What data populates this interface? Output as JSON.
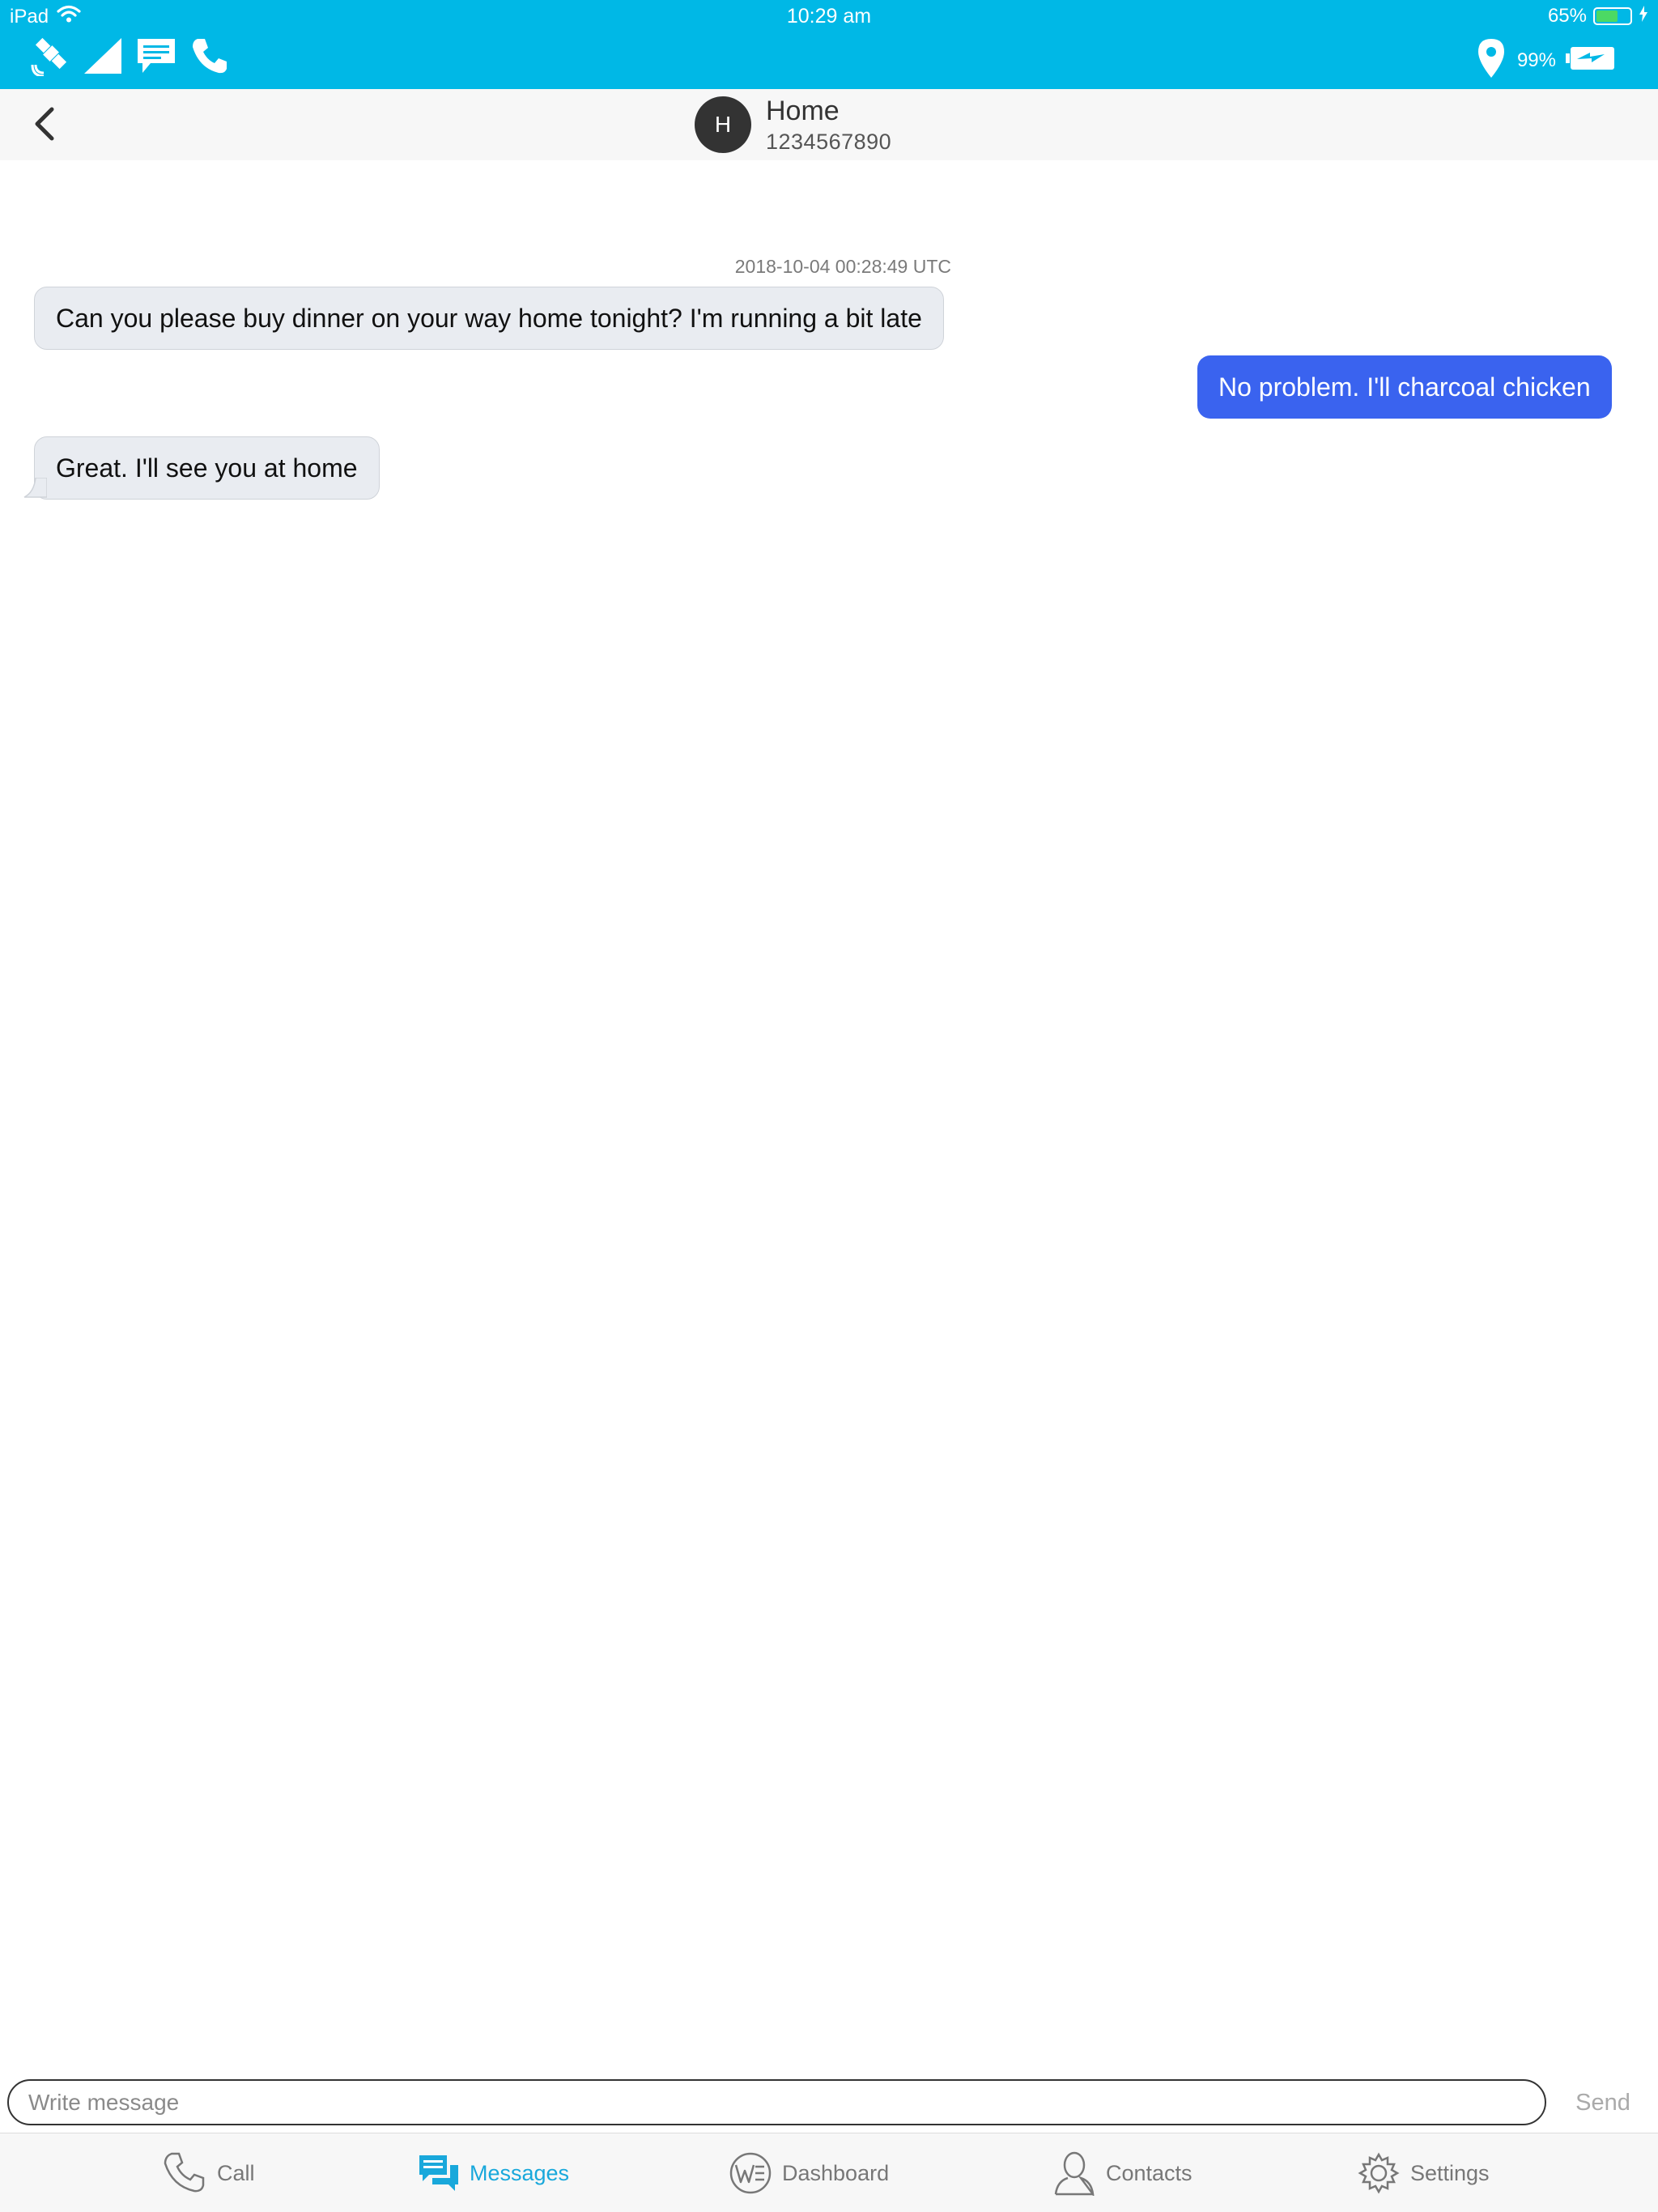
{
  "status_bar": {
    "device": "iPad",
    "time": "10:29 am",
    "battery_percent": "65%",
    "battery_level": 0.65,
    "icons": [
      "wifi-icon",
      "battery-icon",
      "charging-bolt-icon"
    ]
  },
  "app_bar": {
    "left_icons": [
      "satellite-icon",
      "signal-strength-icon",
      "message-bubble-icon",
      "phone-icon"
    ],
    "gps_percent": "99%",
    "right_icons": [
      "location-pin-icon",
      "device-battery-icon"
    ]
  },
  "conversation": {
    "avatar_initial": "H",
    "contact_name": "Home",
    "contact_number": "1234567890",
    "timestamp": "2018-10-04 00:28:49 UTC",
    "messages": [
      {
        "direction": "incoming",
        "text": "Can you please buy dinner on your way home tonight? I'm running a bit late"
      },
      {
        "direction": "outgoing",
        "text": "No problem. I'll charcoal chicken"
      },
      {
        "direction": "incoming",
        "text": "Great. I'll see you at home"
      }
    ]
  },
  "compose": {
    "placeholder": "Write message",
    "send_label": "Send"
  },
  "tabs": [
    {
      "label": "Call",
      "icon": "phone-icon",
      "active": false
    },
    {
      "label": "Messages",
      "icon": "messages-icon",
      "active": true
    },
    {
      "label": "Dashboard",
      "icon": "dashboard-logo-icon",
      "active": false
    },
    {
      "label": "Contacts",
      "icon": "contact-person-icon",
      "active": false
    },
    {
      "label": "Settings",
      "icon": "gear-icon",
      "active": false
    }
  ],
  "colors": {
    "app_bar": "#00b8e6",
    "outgoing_bubble": "#3a63ef",
    "incoming_bubble": "#e9ecf1",
    "active_tab": "#19a8db",
    "battery_fill": "#4cd964"
  }
}
